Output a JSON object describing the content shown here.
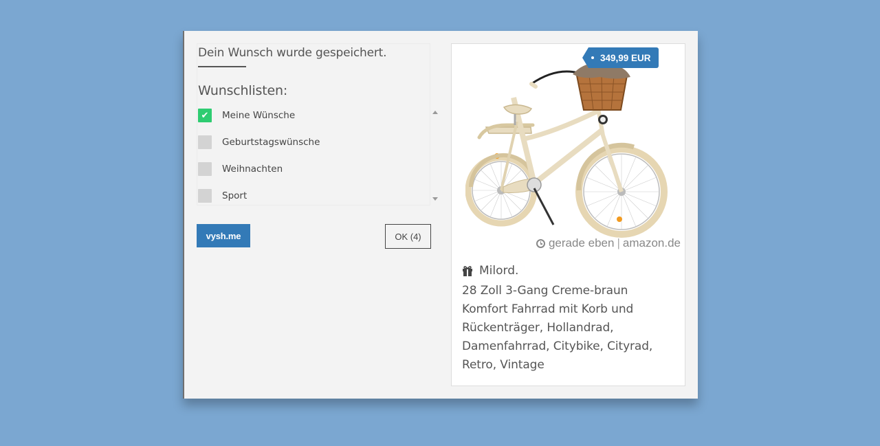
{
  "dialog": {
    "saved_message": "Dein Wunsch wurde gespeichert.",
    "lists_heading": "Wunschlisten:",
    "wishlists": [
      {
        "label": "Meine Wünsche",
        "checked": true
      },
      {
        "label": "Geburtstagswünsche",
        "checked": false
      },
      {
        "label": "Weihnachten",
        "checked": false
      },
      {
        "label": "Sport",
        "checked": false
      }
    ],
    "vysh_button": "vysh.me",
    "ok_button": "OK (4)"
  },
  "product": {
    "price": "349,99 EUR",
    "time": "gerade eben",
    "separator": "|",
    "source": "amazon.de",
    "brand": "Milord.",
    "title": "28 Zoll 3-Gang Creme-braun Komfort Fahrrad mit Korb und Rückenträger, Hollandrad, Damenfahrrad, Citybike, Cityrad, Retro, Vintage"
  },
  "colors": {
    "background": "#7ba7d1",
    "accent_blue": "#337ab7",
    "check_green": "#2ecc71"
  },
  "icons": {
    "checkmark": "check-icon",
    "clock": "clock-icon",
    "gift": "gift-icon"
  }
}
